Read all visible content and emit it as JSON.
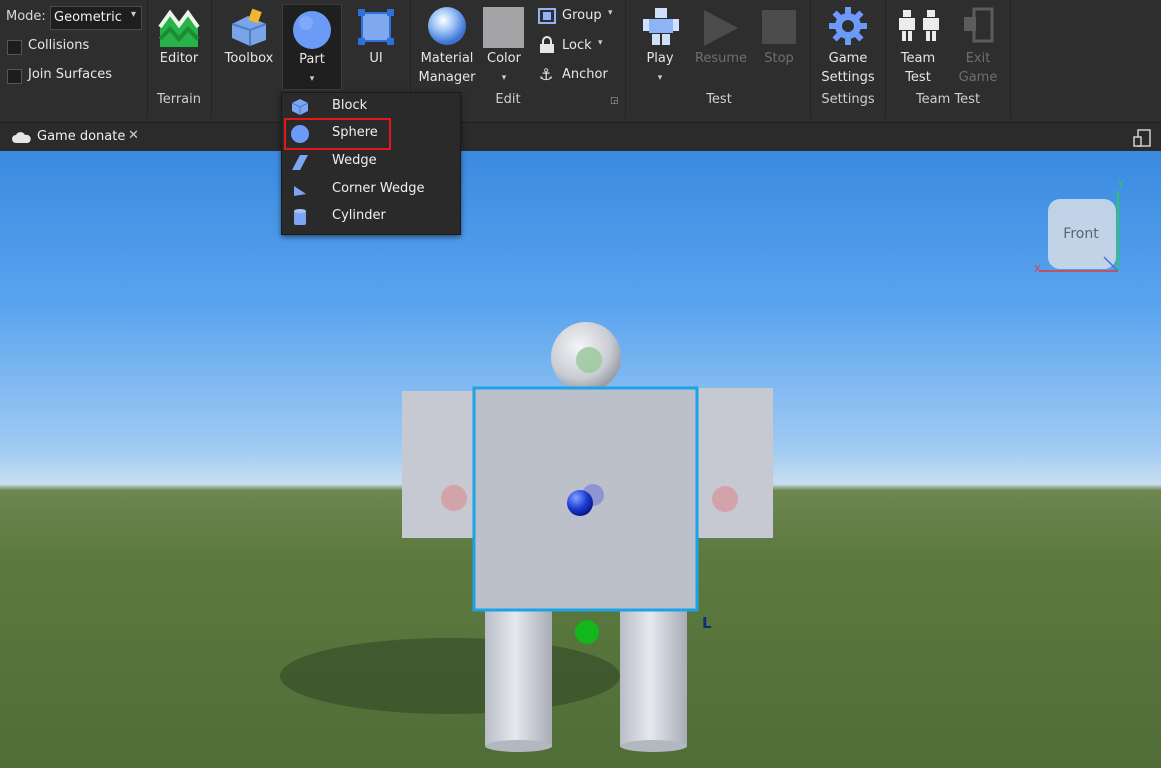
{
  "ribbon": {
    "mode_label": "Mode:",
    "mode_value": "Geometric",
    "collisions": "Collisions",
    "join_surfaces": "Join Surfaces",
    "editor": "Editor",
    "terrain_group": "Terrain",
    "toolbox": "Toolbox",
    "part": "Part",
    "ui": "UI",
    "material_line1": "Material",
    "material_line2": "Manager",
    "color": "Color",
    "group": "Group",
    "lock": "Lock",
    "anchor": "Anchor",
    "edit_group": "Edit",
    "play": "Play",
    "resume": "Resume",
    "stop": "Stop",
    "test_group": "Test",
    "game_settings_line1": "Game",
    "game_settings_line2": "Settings",
    "settings_group": "Settings",
    "team_test_line1": "Team",
    "team_test_line2": "Test",
    "exit_game_line1": "Exit",
    "exit_game_line2": "Game",
    "team_test_group": "Team Test"
  },
  "part_menu": {
    "items": [
      {
        "label": "Block"
      },
      {
        "label": "Sphere"
      },
      {
        "label": "Wedge"
      },
      {
        "label": "Corner Wedge"
      },
      {
        "label": "Cylinder"
      }
    ]
  },
  "tabs": [
    {
      "label": "Game donate"
    }
  ],
  "viewport": {
    "view_cube_label": "Front",
    "axis_y": "Y",
    "axis_x": "X",
    "marker_l": "L"
  },
  "colors": {
    "accent_selection": "#1aa3e8",
    "highlight_box": "#e3161b",
    "part_blue": "#5f8ef5"
  }
}
